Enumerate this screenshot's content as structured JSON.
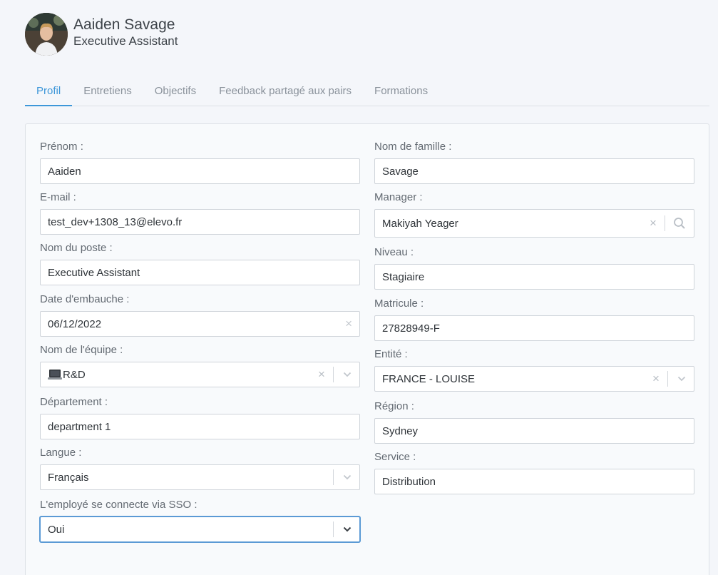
{
  "profile": {
    "name": "Aaiden Savage",
    "job_title": "Executive Assistant"
  },
  "tabs": [
    {
      "label": "Profil",
      "active": true
    },
    {
      "label": "Entretiens",
      "active": false
    },
    {
      "label": "Objectifs",
      "active": false
    },
    {
      "label": "Feedback partagé aux pairs",
      "active": false
    },
    {
      "label": "Formations",
      "active": false
    }
  ],
  "form": {
    "prenom": {
      "label": "Prénom :",
      "value": "Aaiden"
    },
    "nom": {
      "label": "Nom de famille :",
      "value": "Savage"
    },
    "email": {
      "label": "E-mail :",
      "value": "test_dev+1308_13@elevo.fr"
    },
    "manager": {
      "label": "Manager :",
      "value": "Makiyah Yeager"
    },
    "poste": {
      "label": "Nom du poste :",
      "value": "Executive Assistant"
    },
    "niveau": {
      "label": "Niveau :",
      "value": "Stagiaire"
    },
    "embauche": {
      "label": "Date d'embauche :",
      "value": "06/12/2022"
    },
    "matricule": {
      "label": "Matricule :",
      "value": "27828949-F"
    },
    "equipe": {
      "label": "Nom de l'équipe :",
      "value": "R&D",
      "icon": "laptop-emoji"
    },
    "entite": {
      "label": "Entité :",
      "value": "FRANCE - LOUISE"
    },
    "departement": {
      "label": "Département :",
      "value": "department 1"
    },
    "region": {
      "label": "Région :",
      "value": "Sydney"
    },
    "langue": {
      "label": "Langue :",
      "value": "Français"
    },
    "service": {
      "label": "Service :",
      "value": "Distribution"
    },
    "sso": {
      "label": "L'employé se connecte via SSO :",
      "value": "Oui"
    }
  },
  "colors": {
    "accent": "#3d97d9",
    "focus": "#5b9ad5",
    "background": "#f4f6fa"
  }
}
